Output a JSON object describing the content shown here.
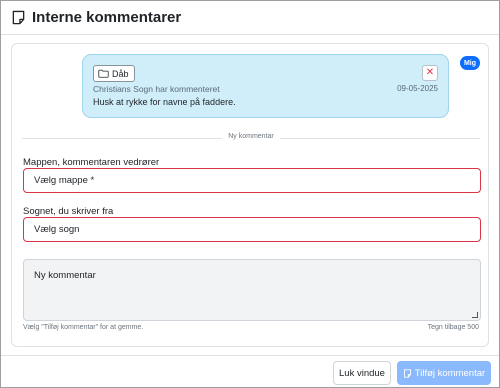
{
  "header": {
    "title": "Interne kommentarer",
    "icon": "note-icon"
  },
  "comment": {
    "folder_label": "Dåb",
    "folder_icon": "folder-icon",
    "author_line": "Christians Sogn har kommenteret",
    "date": "09-05-2025",
    "text": "Husk at rykke for navne på faddere.",
    "close_icon": "close-icon",
    "badge": "Mig",
    "bubble_color": "#cfeefa"
  },
  "divider_label": "Ny kommentar",
  "form": {
    "folder_label": "Mappen, kommentaren vedrører",
    "folder_value": "Vælg mappe *",
    "parish_label": "Sognet, du skriver fra",
    "parish_value": "Vælg sogn",
    "comment_placeholder": "Ny kommentar",
    "hint": "Vælg \"Tilføj kommentar\" for at gemme.",
    "counter": "Tegn tilbage 500",
    "invalid_color": "#dc3545"
  },
  "footer": {
    "close_label": "Luk vindue",
    "add_label": "Tilføj kommentar",
    "primary_color": "#8bb9fe"
  }
}
